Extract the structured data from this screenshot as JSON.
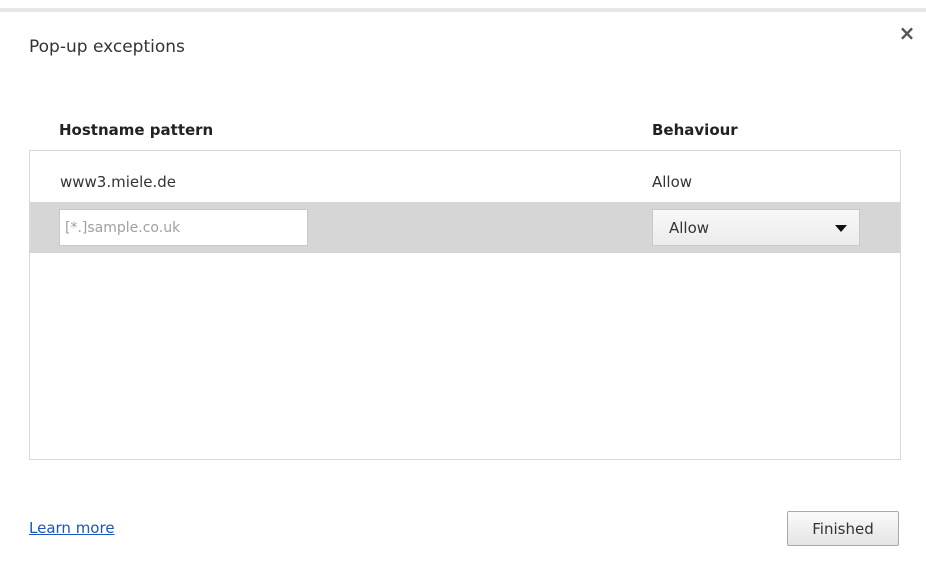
{
  "dialog": {
    "title": "Pop-up exceptions",
    "close_icon": "close-icon",
    "close_glyph": "×"
  },
  "table": {
    "headers": {
      "hostname": "Hostname pattern",
      "behaviour": "Behaviour"
    },
    "rows": [
      {
        "hostname": "www3.miele.de",
        "behaviour": "Allow"
      }
    ],
    "new_entry": {
      "hostname_value": "",
      "hostname_placeholder": "[*.]sample.co.uk",
      "behaviour_selected": "Allow",
      "dropdown_icon": "caret-down-icon"
    }
  },
  "footer": {
    "learn_more": "Learn more",
    "finished_button": "Finished"
  },
  "colors": {
    "link": "#1a55c0",
    "row_highlight": "#d6d6d6",
    "border": "#d9d9d9"
  }
}
